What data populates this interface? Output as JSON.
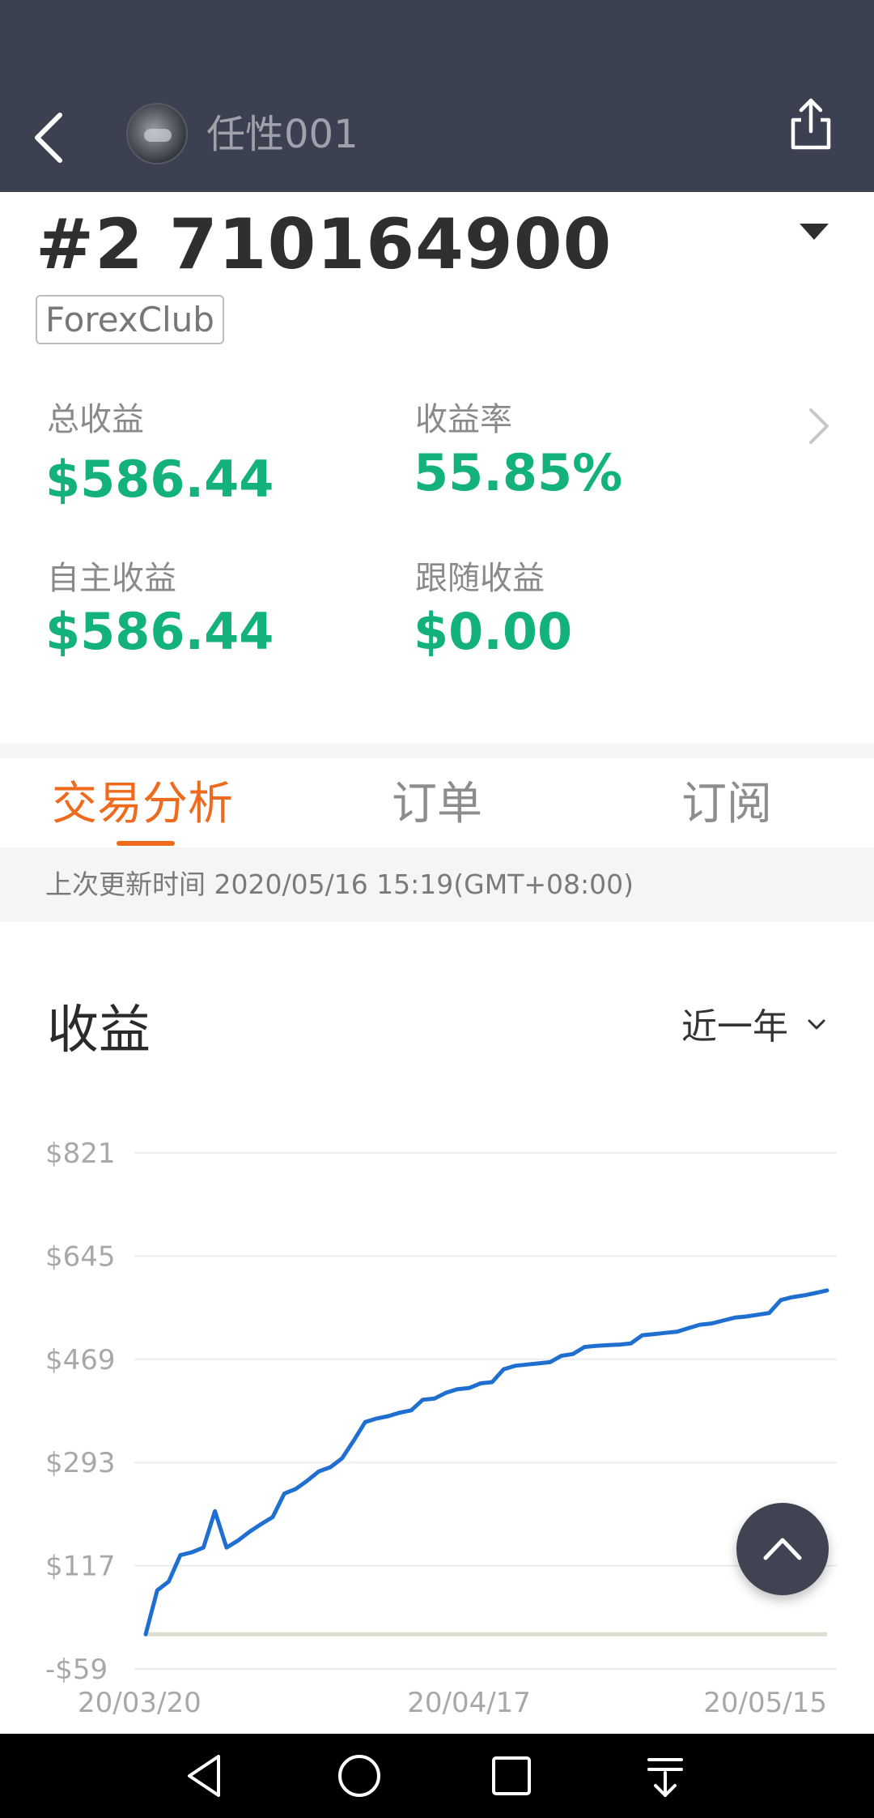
{
  "header": {
    "username": "任性001",
    "back_icon": "back-arrow-icon",
    "share_icon": "share-icon"
  },
  "account": {
    "number": "#2 710164900",
    "broker": "ForexClub"
  },
  "stats": {
    "total_profit_label": "总收益",
    "total_profit_value": "$586.44",
    "return_rate_label": "收益率",
    "return_rate_value": "55.85%",
    "own_profit_label": "自主收益",
    "own_profit_value": "$586.44",
    "follow_profit_label": "跟随收益",
    "follow_profit_value": "$0.00"
  },
  "tabs": [
    {
      "label": "交易分析",
      "active": true
    },
    {
      "label": "订单",
      "active": false
    },
    {
      "label": "订阅",
      "active": false
    }
  ],
  "last_update": "上次更新时间 2020/05/16 15:19(GMT+08:00)",
  "chart_section": {
    "title": "收益",
    "period": "近一年"
  },
  "colors": {
    "header_bg": "#3b4150",
    "accent_orange": "#ee6a1c",
    "profit_green": "#12b27a",
    "line_blue": "#1f6fd1"
  },
  "chart_data": {
    "type": "line",
    "title": "",
    "xlabel": "",
    "ylabel": "",
    "y_ticks": [
      "$821",
      "$645",
      "$469",
      "$293",
      "$117",
      "-$59"
    ],
    "y_tick_values": [
      821,
      645,
      469,
      293,
      117,
      -59
    ],
    "ylim": [
      -59,
      821
    ],
    "x_ticks": [
      "20/03/20",
      "20/04/17",
      "20/05/15"
    ],
    "x_tick_index": [
      0,
      28,
      56
    ],
    "x_range": [
      0,
      59
    ],
    "baseline_value": 0,
    "series": [
      {
        "x": [
          0,
          1,
          2,
          3,
          4,
          5,
          6,
          7,
          8,
          9,
          10,
          11,
          12,
          13,
          14,
          15,
          16,
          17,
          18,
          19,
          20,
          21,
          22,
          23,
          24,
          25,
          26,
          27,
          28,
          29,
          30,
          31,
          32,
          33,
          34,
          35,
          36,
          37,
          38,
          39,
          40,
          41,
          42,
          43,
          44,
          45,
          46,
          47,
          48,
          49,
          50,
          51,
          52,
          53,
          54,
          55,
          56,
          57,
          58,
          59
        ],
        "values": [
          0,
          75,
          90,
          135,
          140,
          148,
          210,
          148,
          160,
          175,
          188,
          200,
          240,
          248,
          262,
          278,
          285,
          300,
          330,
          362,
          368,
          372,
          378,
          382,
          400,
          402,
          412,
          418,
          420,
          428,
          430,
          452,
          458,
          460,
          462,
          464,
          475,
          478,
          490,
          492,
          493,
          494,
          496,
          510,
          512,
          514,
          516,
          522,
          528,
          530,
          535,
          540,
          542,
          545,
          548,
          570,
          575,
          578,
          582,
          586.44
        ]
      }
    ]
  }
}
